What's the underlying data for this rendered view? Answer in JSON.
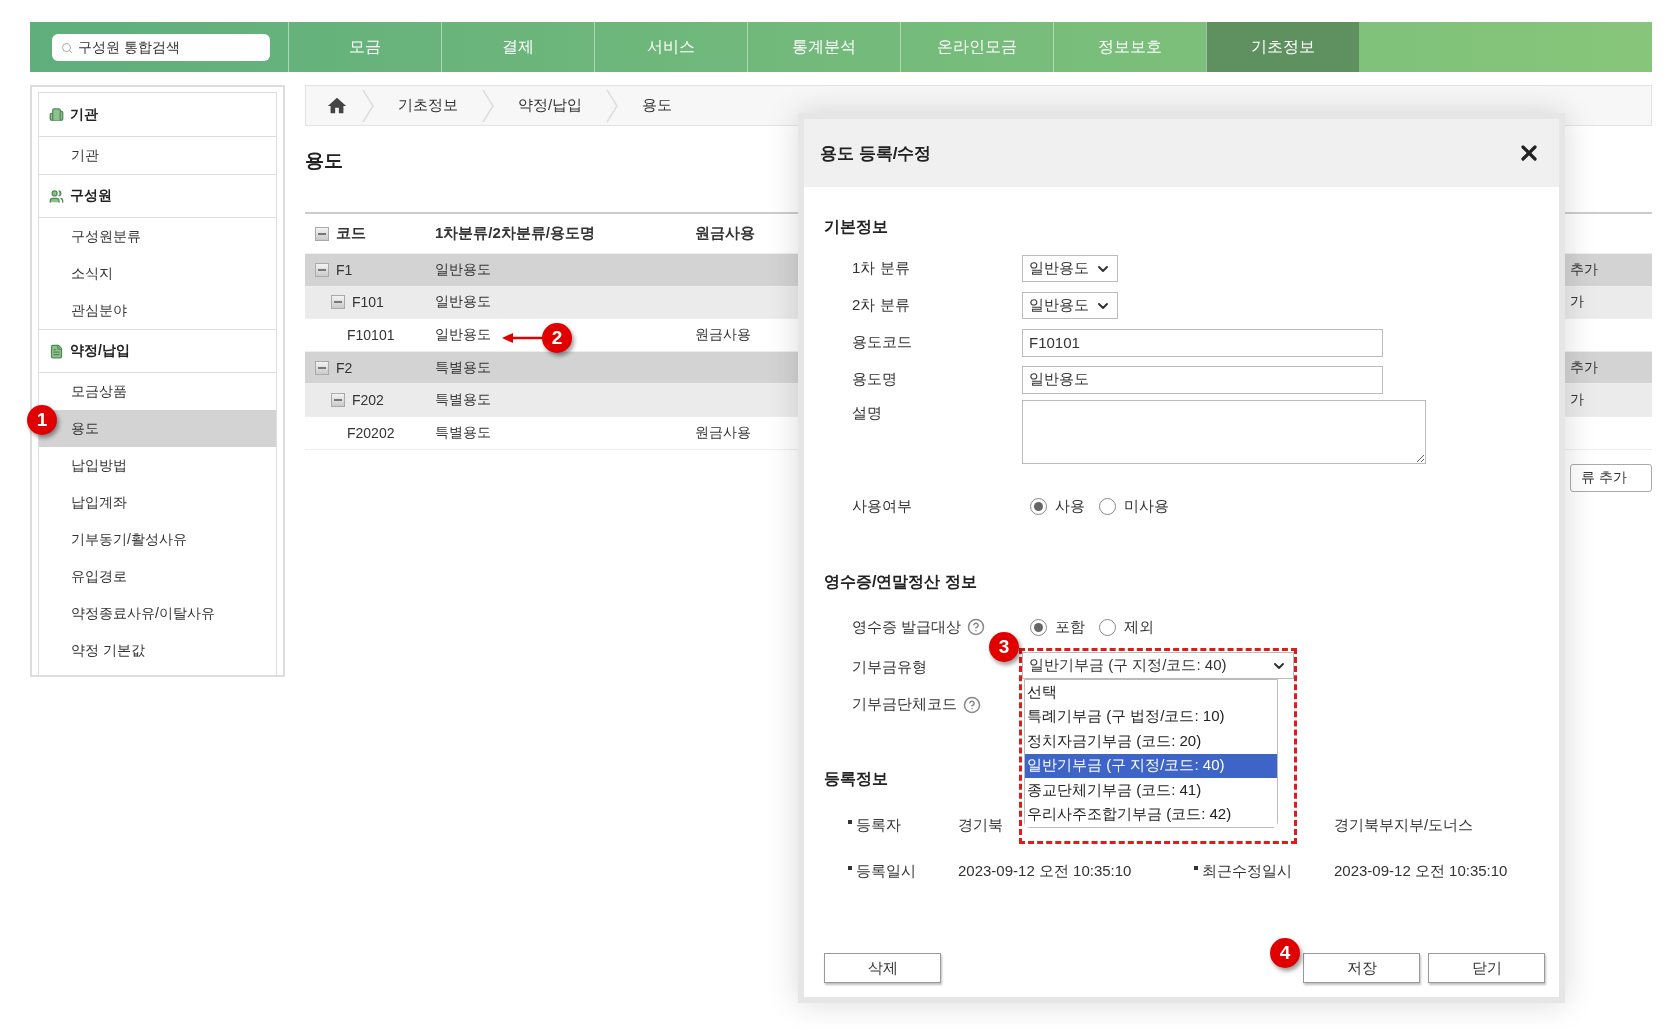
{
  "top_nav": {
    "search": {
      "placeholder": "구성원 통합검색"
    },
    "tabs": [
      {
        "label": "모금",
        "selected": false
      },
      {
        "label": "결제",
        "selected": false
      },
      {
        "label": "서비스",
        "selected": false
      },
      {
        "label": "통계분석",
        "selected": false
      },
      {
        "label": "온라인모금",
        "selected": false
      },
      {
        "label": "정보보호",
        "selected": false
      },
      {
        "label": "기초정보",
        "selected": true
      }
    ]
  },
  "sidebar": {
    "sections": [
      {
        "title": "기관",
        "items": [
          {
            "label": "기관",
            "selected": false
          }
        ]
      },
      {
        "title": "구성원",
        "items": [
          {
            "label": "구성원분류",
            "selected": false
          },
          {
            "label": "소식지",
            "selected": false
          },
          {
            "label": "관심분야",
            "selected": false
          }
        ]
      },
      {
        "title": "약정/납입",
        "items": [
          {
            "label": "모금상품",
            "selected": false
          },
          {
            "label": "용도",
            "selected": true
          },
          {
            "label": "납입방법",
            "selected": false
          },
          {
            "label": "납입계좌",
            "selected": false
          },
          {
            "label": "기부동기/활성사유",
            "selected": false
          },
          {
            "label": "유입경로",
            "selected": false
          },
          {
            "label": "약정종료사유/이탈사유",
            "selected": false
          },
          {
            "label": "약정 기본값",
            "selected": false
          }
        ]
      }
    ]
  },
  "breadcrumb": [
    "기초정보",
    "약정/납입",
    "용도"
  ],
  "page_title": "용도",
  "table": {
    "columns": [
      "코드",
      "1차분류/2차분류/용도명",
      "원금사용"
    ],
    "rows": [
      {
        "code": "F1",
        "name": "일반용도",
        "expanded": true,
        "column_4": "추가",
        "children": [
          {
            "code": "F101",
            "name": "일반용도",
            "expanded": true,
            "column_4": "가",
            "children": [
              {
                "code": "F10101",
                "name": "일반용도",
                "principal": "원금사용"
              }
            ]
          }
        ]
      },
      {
        "code": "F2",
        "name": "특별용도",
        "expanded": true,
        "column_4": "추가",
        "children": [
          {
            "code": "F202",
            "name": "특별용도",
            "expanded": true,
            "column_4": "가",
            "children": [
              {
                "code": "F20202",
                "name": "특별용도",
                "principal": "원금사용"
              }
            ]
          }
        ]
      }
    ],
    "below_button": "류 추가"
  },
  "modal": {
    "title": "용도 등록/수정",
    "sections": [
      {
        "title": "기본정보",
        "fields": [
          {
            "kind": "select",
            "label": "1차 분류",
            "value": "일반용도"
          },
          {
            "kind": "select",
            "label": "2차 분류",
            "value": "일반용도"
          },
          {
            "kind": "text",
            "label": "용도코드",
            "value": "F10101"
          },
          {
            "kind": "text",
            "label": "용도명",
            "value": "일반용도"
          },
          {
            "kind": "textarea",
            "label": "설명"
          },
          {
            "kind": "radio",
            "label": "사용여부",
            "options": [
              {
                "label": "사용",
                "selected": true
              },
              {
                "label": "미사용",
                "selected": false
              }
            ]
          }
        ]
      },
      {
        "title": "영수증/연말정산 정보",
        "fields": [
          {
            "kind": "radio",
            "label": "영수증 발급대상",
            "help": true,
            "options": [
              {
                "label": "포함",
                "selected": true
              },
              {
                "label": "제외",
                "selected": false
              }
            ]
          },
          {
            "kind": "select",
            "label": "기부금유형",
            "value": "일반기부금 (구 지정/코드: 40)",
            "open": true,
            "options": [
              {
                "label": "선택",
                "selected": false
              },
              {
                "label": "특례기부금 (구 법정/코드: 10)",
                "selected": false
              },
              {
                "label": "정치자금기부금 (코드: 20)",
                "selected": false
              },
              {
                "label": "일반기부금 (구 지정/코드: 40)",
                "selected": true
              },
              {
                "label": "종교단체기부금 (코드: 41)",
                "selected": false
              },
              {
                "label": "우리사주조합기부금 (코드: 42)",
                "selected": false
              }
            ]
          },
          {
            "kind": "blank",
            "label": "기부금단체코드",
            "help": true
          }
        ]
      }
    ],
    "registration": {
      "title": "등록정보",
      "rows": [
        [
          {
            "label": "등록자",
            "value": "경기북"
          },
          {
            "value": "경기북부지부/도너스"
          }
        ],
        [
          {
            "label": "등록일시",
            "value": "2023-09-12 오전 10:35:10"
          },
          {
            "label": "최근수정일시",
            "value": "2023-09-12 오전 10:35:10"
          }
        ]
      ]
    },
    "buttons_left": [
      "삭제"
    ],
    "buttons_right": [
      "저장",
      "닫기"
    ]
  },
  "annotations": [
    {
      "number": "1",
      "arrow": false
    },
    {
      "number": "2",
      "arrow": true
    },
    {
      "number": "3",
      "arrow": false
    },
    {
      "number": "4",
      "arrow": false
    }
  ]
}
